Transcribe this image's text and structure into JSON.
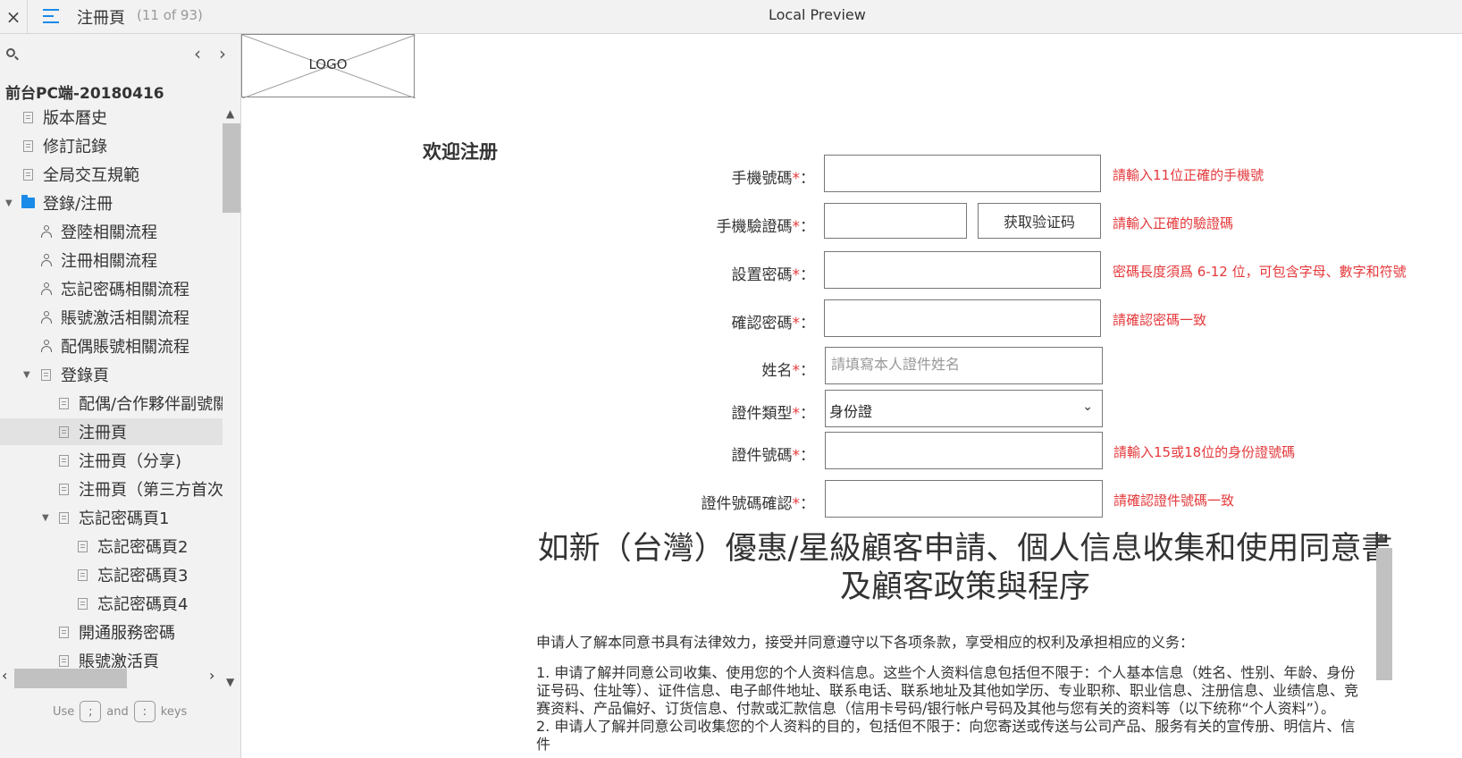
{
  "topbar": {
    "close": "×",
    "page_name": "注冊頁",
    "page_count": "(11 of 93)",
    "app_title": "Local Preview"
  },
  "sidebar": {
    "prev": "‹",
    "next": "›",
    "project_title": "前台PC端-20180416",
    "items": [
      {
        "label": "版本曆史",
        "icon": "doc-icon"
      },
      {
        "label": "修訂記錄",
        "icon": "doc-icon"
      },
      {
        "label": "全局交互規範",
        "icon": "doc-icon"
      },
      {
        "label": "登錄/注冊",
        "icon": "folder-icon"
      },
      {
        "label": "登陸相關流程",
        "icon": "flow-icon"
      },
      {
        "label": "注冊相關流程",
        "icon": "flow-icon"
      },
      {
        "label": "忘記密碼相關流程",
        "icon": "flow-icon"
      },
      {
        "label": "賬號激活相關流程",
        "icon": "flow-icon"
      },
      {
        "label": "配偶賬號相關流程",
        "icon": "flow-icon"
      },
      {
        "label": "登錄頁",
        "icon": "doc-icon"
      },
      {
        "label": "配偶/合作夥伴副號關",
        "icon": "doc-icon"
      },
      {
        "label": "注冊頁",
        "icon": "doc-icon"
      },
      {
        "label": "注冊頁（分享)",
        "icon": "doc-icon"
      },
      {
        "label": "注冊頁（第三方首次",
        "icon": "doc-icon"
      },
      {
        "label": "忘記密碼頁1",
        "icon": "doc-icon"
      },
      {
        "label": "忘記密碼頁2",
        "icon": "doc-icon"
      },
      {
        "label": "忘記密碼頁3",
        "icon": "doc-icon"
      },
      {
        "label": "忘記密碼頁4",
        "icon": "doc-icon"
      },
      {
        "label": "開通服務密碼",
        "icon": "doc-icon"
      },
      {
        "label": "賬號激活頁",
        "icon": "doc-icon"
      }
    ],
    "hint": {
      "use": "Use",
      "and": "and",
      "keys": "keys",
      "key1": ";",
      "key2": ":"
    }
  },
  "main": {
    "logo": "LOGO",
    "welcome": "欢迎注册",
    "req_mark": "*",
    "form": {
      "phone_label": "手機號碼",
      "phone_error": "請輸入11位正確的手機號",
      "code_label": "手機驗證碼",
      "code_button": "获取验证码",
      "code_error": "請輸入正確的驗證碼",
      "password_label": "設置密碼",
      "password_error": "密碼長度須爲 6-12 位，可包含字母、數字和符號",
      "confirm_label": "確認密碼",
      "confirm_error": "請確認密碼一致",
      "name_label": "姓名",
      "name_placeholder": "請填寫本人證件姓名",
      "idtype_label": "證件類型",
      "idtype_value": "身份證",
      "idno_label": "證件號碼",
      "idno_error": "請輸入15或18位的身份證號碼",
      "idconfirm_label": "證件號碼確認",
      "idconfirm_error": "請確認證件號碼一致",
      "colon": "："
    },
    "agreement": {
      "title": "如新（台灣）優惠/星級顧客申請、個人信息收集和使用同意書及顧客政策與程序",
      "intro": "申请人了解本同意书具有法律效力，接受并同意遵守以下各项条款，享受相应的权利及承担相应的义务：",
      "p1": "1.    申请了解并同意公司收集、使用您的个人资料信息。这些个人资料信息包括但不限于：个人基本信息（姓名、性别、年龄、身份证号码、住址等）、证件信息、电子邮件地址、联系电话、联系地址及其他如学历、专业职称、职业信息、注册信息、业绩信息、竞赛资料、产品偏好、订货信息、付款或汇款信息（信用卡号码/银行帐户号码及其他与您有关的资料等（以下统称“个人资料”）。",
      "p2": "2.    申请人了解并同意公司收集您的个人资料的目的，包括但不限于：向您寄送或传送与公司产品、服务有关的宣传册、明信片、信件"
    }
  }
}
